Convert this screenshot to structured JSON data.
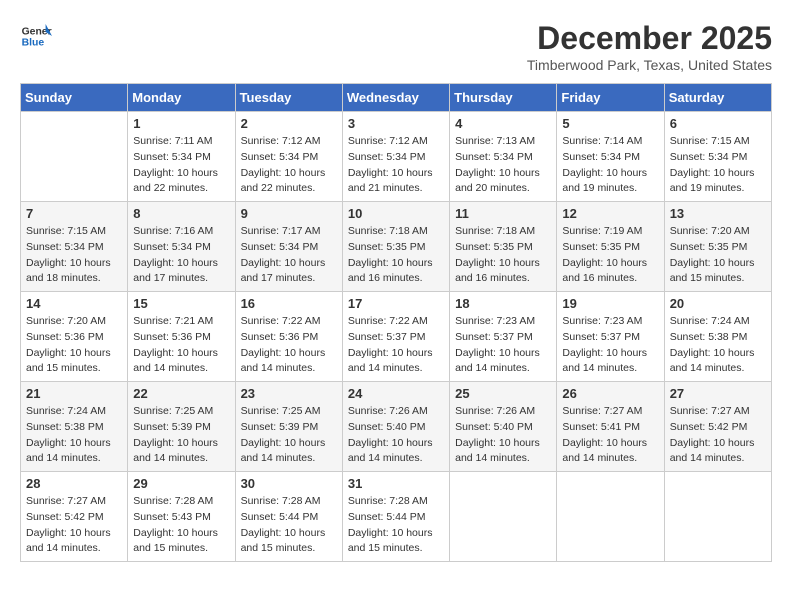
{
  "header": {
    "logo_line1": "General",
    "logo_line2": "Blue",
    "month": "December 2025",
    "location": "Timberwood Park, Texas, United States"
  },
  "weekdays": [
    "Sunday",
    "Monday",
    "Tuesday",
    "Wednesday",
    "Thursday",
    "Friday",
    "Saturday"
  ],
  "weeks": [
    [
      {
        "day": "",
        "info": ""
      },
      {
        "day": "1",
        "info": "Sunrise: 7:11 AM\nSunset: 5:34 PM\nDaylight: 10 hours\nand 22 minutes."
      },
      {
        "day": "2",
        "info": "Sunrise: 7:12 AM\nSunset: 5:34 PM\nDaylight: 10 hours\nand 22 minutes."
      },
      {
        "day": "3",
        "info": "Sunrise: 7:12 AM\nSunset: 5:34 PM\nDaylight: 10 hours\nand 21 minutes."
      },
      {
        "day": "4",
        "info": "Sunrise: 7:13 AM\nSunset: 5:34 PM\nDaylight: 10 hours\nand 20 minutes."
      },
      {
        "day": "5",
        "info": "Sunrise: 7:14 AM\nSunset: 5:34 PM\nDaylight: 10 hours\nand 19 minutes."
      },
      {
        "day": "6",
        "info": "Sunrise: 7:15 AM\nSunset: 5:34 PM\nDaylight: 10 hours\nand 19 minutes."
      }
    ],
    [
      {
        "day": "7",
        "info": "Sunrise: 7:15 AM\nSunset: 5:34 PM\nDaylight: 10 hours\nand 18 minutes."
      },
      {
        "day": "8",
        "info": "Sunrise: 7:16 AM\nSunset: 5:34 PM\nDaylight: 10 hours\nand 17 minutes."
      },
      {
        "day": "9",
        "info": "Sunrise: 7:17 AM\nSunset: 5:34 PM\nDaylight: 10 hours\nand 17 minutes."
      },
      {
        "day": "10",
        "info": "Sunrise: 7:18 AM\nSunset: 5:35 PM\nDaylight: 10 hours\nand 16 minutes."
      },
      {
        "day": "11",
        "info": "Sunrise: 7:18 AM\nSunset: 5:35 PM\nDaylight: 10 hours\nand 16 minutes."
      },
      {
        "day": "12",
        "info": "Sunrise: 7:19 AM\nSunset: 5:35 PM\nDaylight: 10 hours\nand 16 minutes."
      },
      {
        "day": "13",
        "info": "Sunrise: 7:20 AM\nSunset: 5:35 PM\nDaylight: 10 hours\nand 15 minutes."
      }
    ],
    [
      {
        "day": "14",
        "info": "Sunrise: 7:20 AM\nSunset: 5:36 PM\nDaylight: 10 hours\nand 15 minutes."
      },
      {
        "day": "15",
        "info": "Sunrise: 7:21 AM\nSunset: 5:36 PM\nDaylight: 10 hours\nand 14 minutes."
      },
      {
        "day": "16",
        "info": "Sunrise: 7:22 AM\nSunset: 5:36 PM\nDaylight: 10 hours\nand 14 minutes."
      },
      {
        "day": "17",
        "info": "Sunrise: 7:22 AM\nSunset: 5:37 PM\nDaylight: 10 hours\nand 14 minutes."
      },
      {
        "day": "18",
        "info": "Sunrise: 7:23 AM\nSunset: 5:37 PM\nDaylight: 10 hours\nand 14 minutes."
      },
      {
        "day": "19",
        "info": "Sunrise: 7:23 AM\nSunset: 5:37 PM\nDaylight: 10 hours\nand 14 minutes."
      },
      {
        "day": "20",
        "info": "Sunrise: 7:24 AM\nSunset: 5:38 PM\nDaylight: 10 hours\nand 14 minutes."
      }
    ],
    [
      {
        "day": "21",
        "info": "Sunrise: 7:24 AM\nSunset: 5:38 PM\nDaylight: 10 hours\nand 14 minutes."
      },
      {
        "day": "22",
        "info": "Sunrise: 7:25 AM\nSunset: 5:39 PM\nDaylight: 10 hours\nand 14 minutes."
      },
      {
        "day": "23",
        "info": "Sunrise: 7:25 AM\nSunset: 5:39 PM\nDaylight: 10 hours\nand 14 minutes."
      },
      {
        "day": "24",
        "info": "Sunrise: 7:26 AM\nSunset: 5:40 PM\nDaylight: 10 hours\nand 14 minutes."
      },
      {
        "day": "25",
        "info": "Sunrise: 7:26 AM\nSunset: 5:40 PM\nDaylight: 10 hours\nand 14 minutes."
      },
      {
        "day": "26",
        "info": "Sunrise: 7:27 AM\nSunset: 5:41 PM\nDaylight: 10 hours\nand 14 minutes."
      },
      {
        "day": "27",
        "info": "Sunrise: 7:27 AM\nSunset: 5:42 PM\nDaylight: 10 hours\nand 14 minutes."
      }
    ],
    [
      {
        "day": "28",
        "info": "Sunrise: 7:27 AM\nSunset: 5:42 PM\nDaylight: 10 hours\nand 14 minutes."
      },
      {
        "day": "29",
        "info": "Sunrise: 7:28 AM\nSunset: 5:43 PM\nDaylight: 10 hours\nand 15 minutes."
      },
      {
        "day": "30",
        "info": "Sunrise: 7:28 AM\nSunset: 5:44 PM\nDaylight: 10 hours\nand 15 minutes."
      },
      {
        "day": "31",
        "info": "Sunrise: 7:28 AM\nSunset: 5:44 PM\nDaylight: 10 hours\nand 15 minutes."
      },
      {
        "day": "",
        "info": ""
      },
      {
        "day": "",
        "info": ""
      },
      {
        "day": "",
        "info": ""
      }
    ]
  ]
}
